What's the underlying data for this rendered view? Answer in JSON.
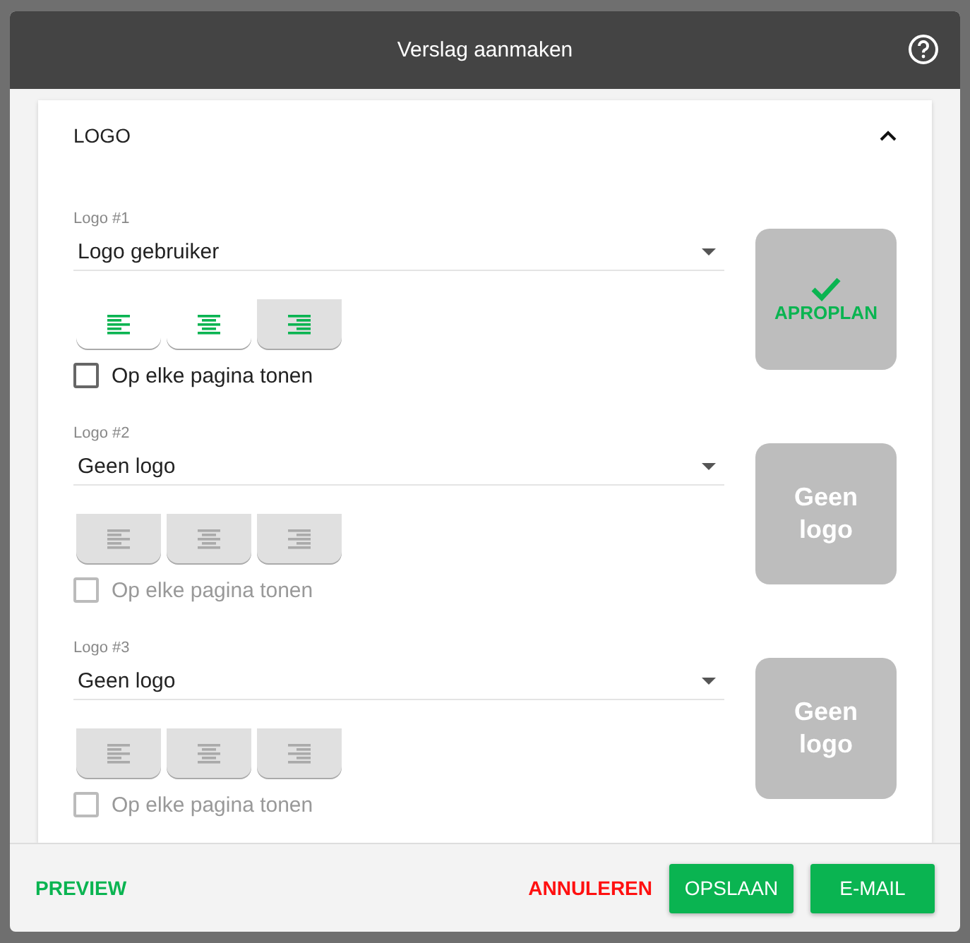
{
  "dialog": {
    "title": "Verslag aanmaken"
  },
  "section": {
    "title": "LOGO",
    "expanded": true
  },
  "logos": [
    {
      "label": "Logo #1",
      "value": "Logo gebruiker",
      "disabled": false,
      "alignments": [
        {
          "kind": "left",
          "selected": false
        },
        {
          "kind": "center",
          "selected": false
        },
        {
          "kind": "right",
          "selected": true
        }
      ],
      "show_on_every_page": {
        "label": "Op elke pagina tonen",
        "checked": false
      },
      "preview": {
        "kind": "brand",
        "text": "APROPLAN"
      }
    },
    {
      "label": "Logo #2",
      "value": "Geen logo",
      "disabled": true,
      "alignments": [
        {
          "kind": "left",
          "selected": false
        },
        {
          "kind": "center",
          "selected": false
        },
        {
          "kind": "right",
          "selected": false
        }
      ],
      "show_on_every_page": {
        "label": "Op elke pagina tonen",
        "checked": false
      },
      "preview": {
        "kind": "text",
        "text": "Geen logo"
      }
    },
    {
      "label": "Logo #3",
      "value": "Geen logo",
      "disabled": true,
      "alignments": [
        {
          "kind": "left",
          "selected": false
        },
        {
          "kind": "center",
          "selected": false
        },
        {
          "kind": "right",
          "selected": false
        }
      ],
      "show_on_every_page": {
        "label": "Op elke pagina tonen",
        "checked": false
      },
      "preview": {
        "kind": "text",
        "text": "Geen logo"
      }
    }
  ],
  "footer": {
    "preview": "PREVIEW",
    "cancel": "ANNULEREN",
    "save": "OPSLAAN",
    "email": "E-MAIL"
  }
}
